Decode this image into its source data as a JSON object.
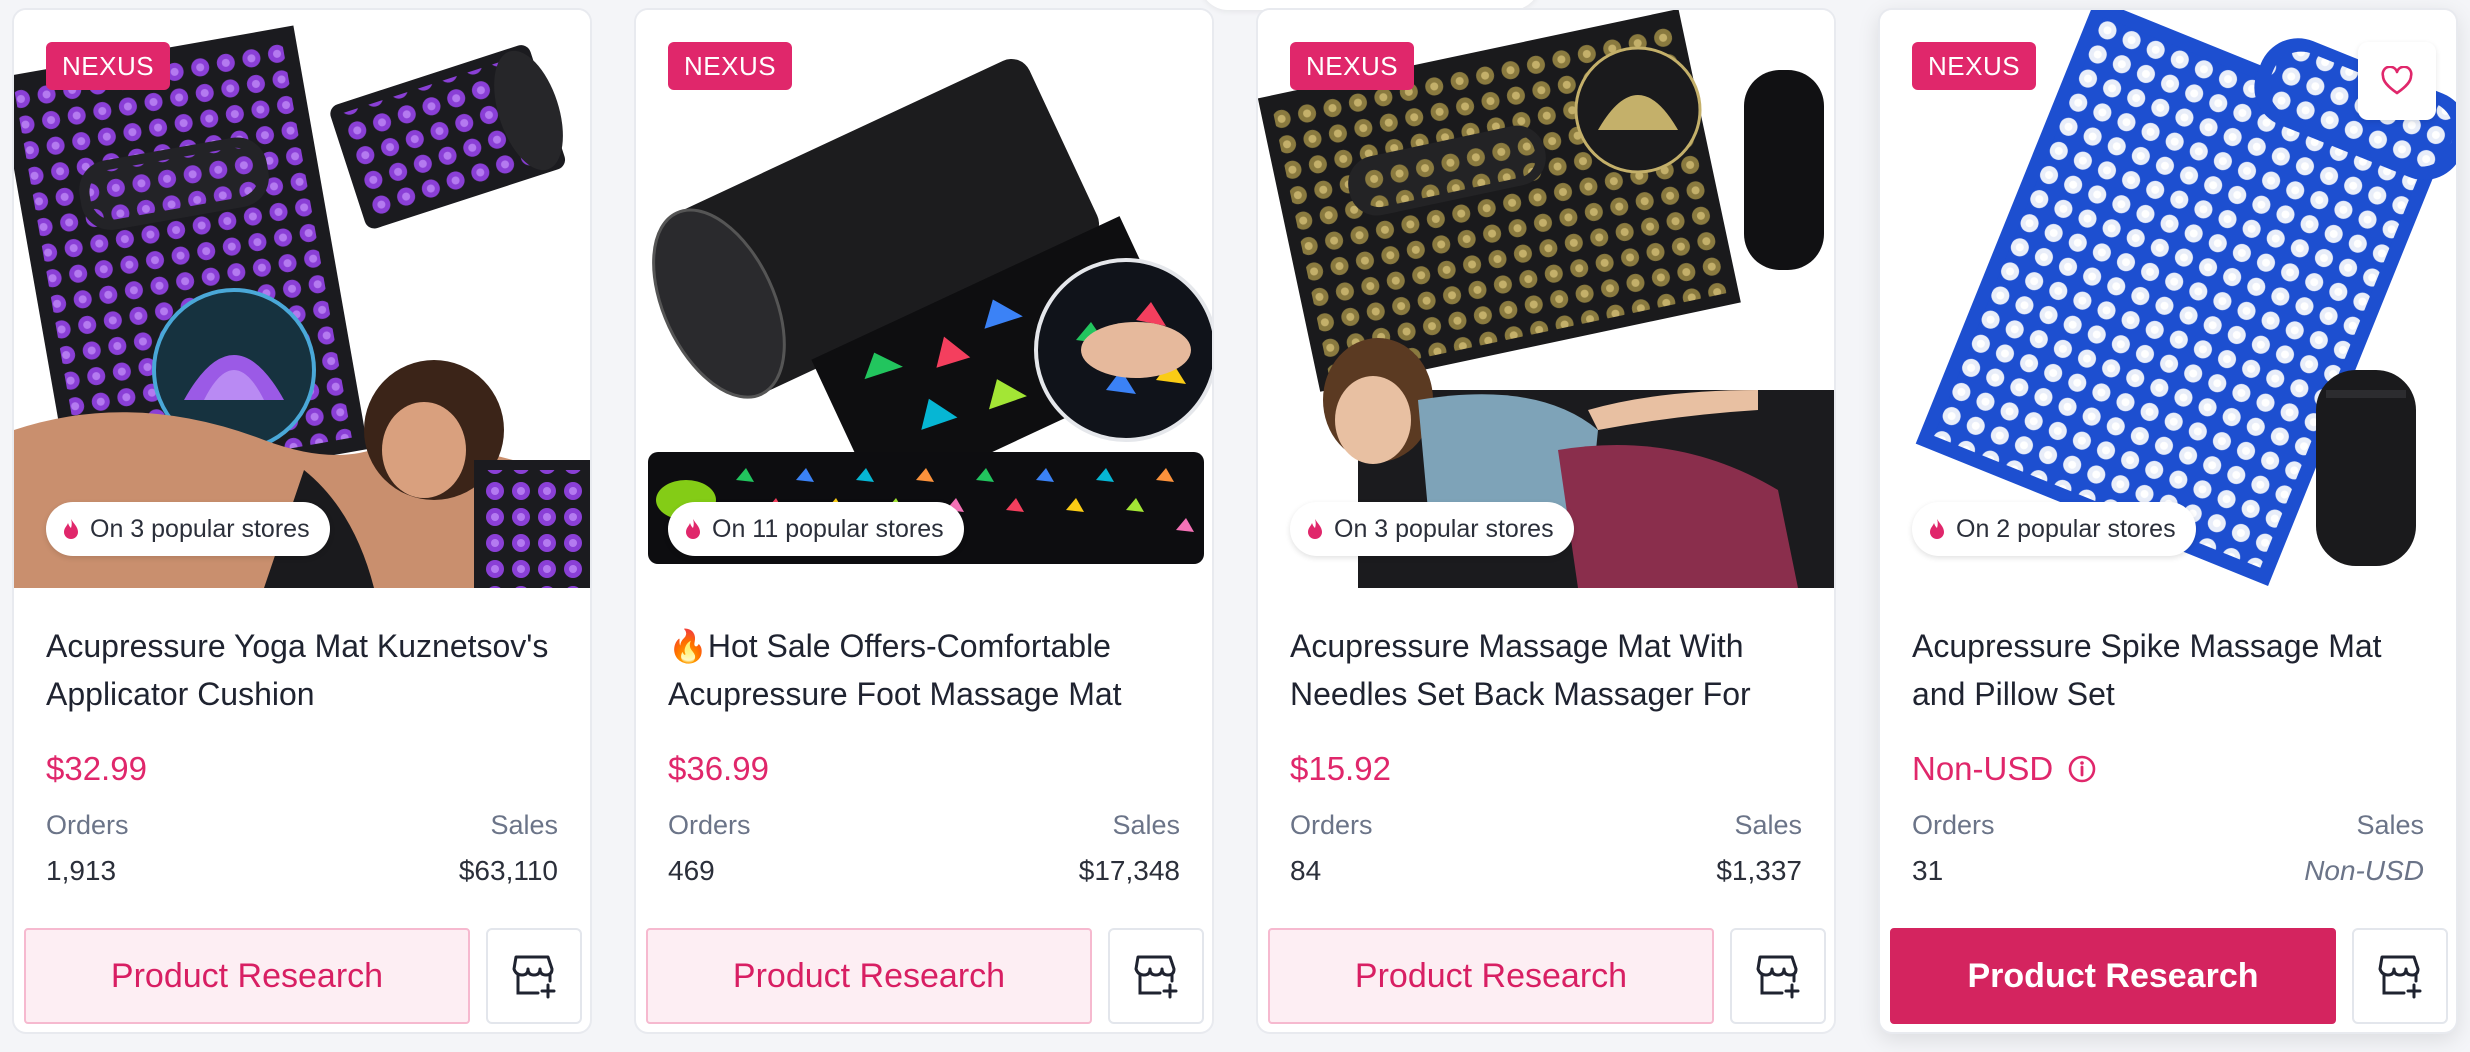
{
  "colors": {
    "accent": "#e0276b",
    "button_bg": "#fdeef3",
    "button_active": "#d4245f"
  },
  "cards": [
    {
      "badge": "NEXUS",
      "popularity": "On 3 popular stores",
      "title": "Acupressure Yoga Mat Kuznetsov's Applicator Cushion",
      "price": "$32.99",
      "orders_label": "Orders",
      "sales_label": "Sales",
      "orders": "1,913",
      "sales": "$63,110",
      "button": "Product Research",
      "store_icon": "store-add-icon"
    },
    {
      "badge": "NEXUS",
      "popularity": "On 11 popular stores",
      "title": "🔥Hot Sale Offers-Comfortable Acupressure Foot Massage Mat",
      "price": "$36.99",
      "orders_label": "Orders",
      "sales_label": "Sales",
      "orders": "469",
      "sales": "$17,348",
      "button": "Product Research",
      "store_icon": "store-add-icon"
    },
    {
      "badge": "NEXUS",
      "popularity": "On 3 popular stores",
      "title": "Acupressure Massage Mat With Needles Set Back Massager For",
      "price": "$15.92",
      "orders_label": "Orders",
      "sales_label": "Sales",
      "orders": "84",
      "sales": "$1,337",
      "button": "Product Research",
      "store_icon": "store-add-icon"
    },
    {
      "badge": "NEXUS",
      "popularity": "On 2 popular stores",
      "title": "Acupressure Spike Massage Mat and Pillow Set",
      "price": "Non-USD",
      "orders_label": "Orders",
      "sales_label": "Sales",
      "orders": "31",
      "sales": "Non-USD",
      "button": "Product Research",
      "store_icon": "store-add-icon",
      "favorite_icon": "heart-icon"
    }
  ]
}
